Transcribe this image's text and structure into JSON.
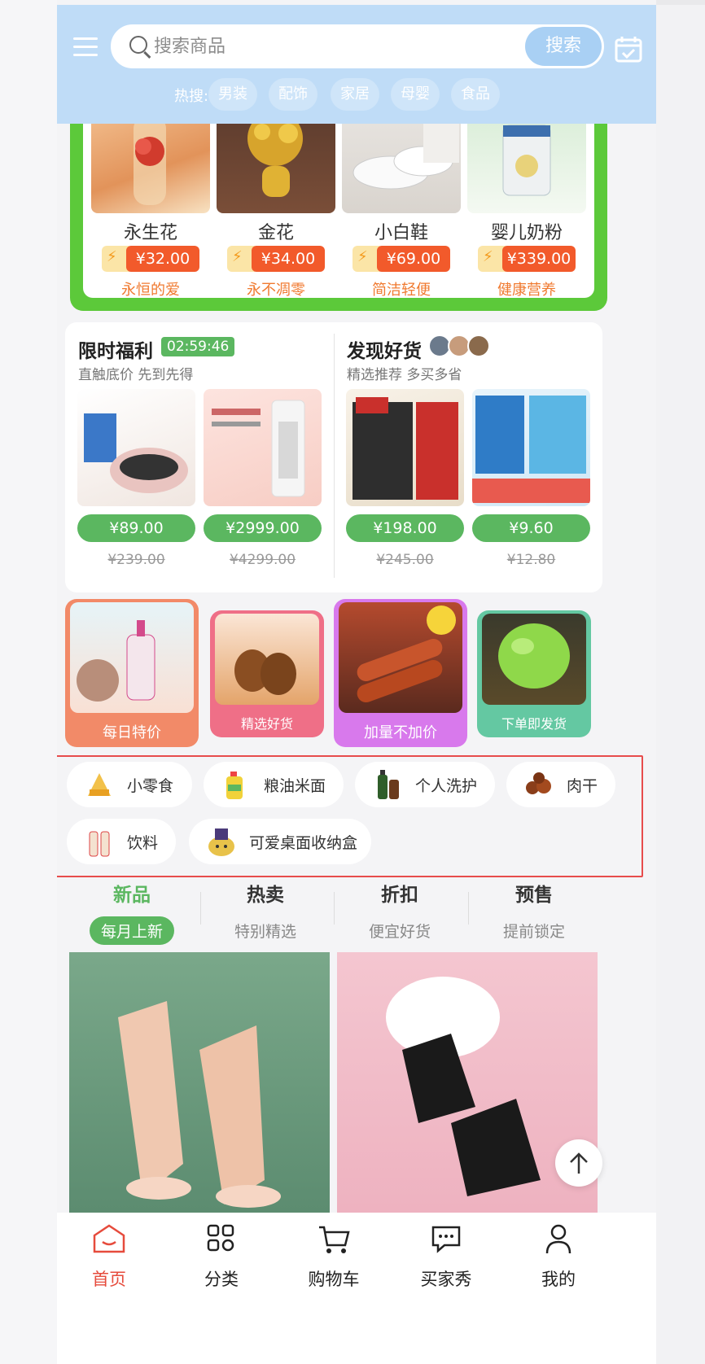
{
  "search": {
    "placeholder": "搜索商品",
    "button": "搜索"
  },
  "hot": {
    "label": "热搜:",
    "tags": [
      "男装",
      "配饰",
      "家居",
      "母婴",
      "食品"
    ]
  },
  "promo": [
    {
      "name": "永生花",
      "price": "¥32.00",
      "tagline": "永恒的爱"
    },
    {
      "name": "金花",
      "price": "¥34.00",
      "tagline": "永不凋零"
    },
    {
      "name": "小白鞋",
      "price": "¥69.00",
      "tagline": "简洁轻便"
    },
    {
      "name": "婴儿奶粉",
      "price": "¥339.00",
      "tagline": "健康营养"
    }
  ],
  "flash": {
    "title": "限时福利",
    "timer": "02:59:46",
    "subtitle": "直触底价 先到先得",
    "items": [
      {
        "now": "¥89.00",
        "was": "¥239.00"
      },
      {
        "now": "¥2999.00",
        "was": "¥4299.00"
      }
    ]
  },
  "discover": {
    "title": "发现好货",
    "subtitle": "精选推荐 多买多省",
    "items": [
      {
        "now": "¥198.00",
        "was": "¥245.00"
      },
      {
        "now": "¥9.60",
        "was": "¥12.80"
      }
    ]
  },
  "tiles": [
    "每日特价",
    "精选好货",
    "加量不加价",
    "下单即发货"
  ],
  "chips": [
    "小零食",
    "粮油米面",
    "个人洗护",
    "肉干",
    "饮料",
    "可爱桌面收纳盒"
  ],
  "tabs": [
    {
      "title": "新品",
      "sub": "每月上新"
    },
    {
      "title": "热卖",
      "sub": "特别精选"
    },
    {
      "title": "折扣",
      "sub": "便宜好货"
    },
    {
      "title": "预售",
      "sub": "提前锁定"
    }
  ],
  "nav": [
    "首页",
    "分类",
    "购物车",
    "买家秀",
    "我的"
  ],
  "colors": {
    "header": "#bfdcf7",
    "accent_green": "#5bb760",
    "promo_green": "#5cc93a",
    "price_red": "#f25a2b",
    "nav_active": "#e64b3c",
    "highlight_box": "#e74c4c"
  }
}
